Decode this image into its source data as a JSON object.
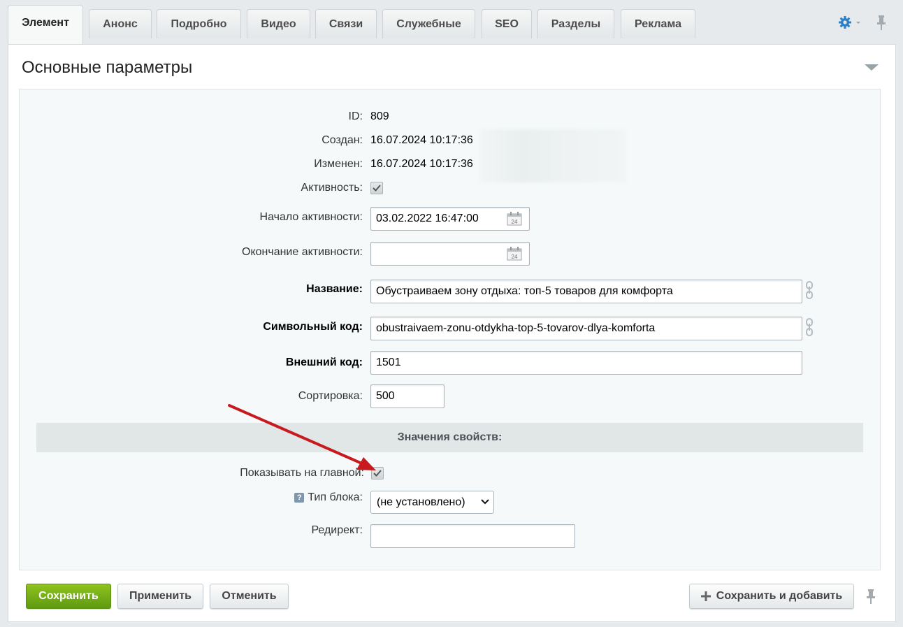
{
  "tabs": [
    {
      "label": "Элемент",
      "active": true
    },
    {
      "label": "Анонс"
    },
    {
      "label": "Подробно"
    },
    {
      "label": "Видео"
    },
    {
      "label": "Связи"
    },
    {
      "label": "Служебные"
    },
    {
      "label": "SEO"
    },
    {
      "label": "Разделы"
    },
    {
      "label": "Реклама"
    }
  ],
  "section": {
    "title": "Основные параметры"
  },
  "fields": {
    "id": {
      "label": "ID:",
      "value": "809"
    },
    "created": {
      "label": "Создан:",
      "value": "16.07.2024 10:17:36"
    },
    "modified": {
      "label": "Изменен:",
      "value": "16.07.2024 10:17:36"
    },
    "active": {
      "label": "Активность:",
      "checked": true
    },
    "active_from": {
      "label": "Начало активности:",
      "value": "03.02.2022 16:47:00"
    },
    "active_to": {
      "label": "Окончание активности:",
      "value": ""
    },
    "name": {
      "label": "Название:",
      "value": "Обустраиваем зону отдыха: топ-5 товаров для комфорта"
    },
    "code": {
      "label": "Символьный код:",
      "value": "obustraivaem-zonu-otdykha-top-5-tovarov-dlya-komforta"
    },
    "xml_id": {
      "label": "Внешний код:",
      "value": "1501"
    },
    "sort": {
      "label": "Сортировка:",
      "value": "500"
    }
  },
  "properties": {
    "header": "Значения свойств:",
    "show_on_main": {
      "label": "Показывать на главной:",
      "checked": true
    },
    "block_type": {
      "label": "Тип блока:",
      "help_icon": "?",
      "selected": "(не установлено)"
    },
    "redirect": {
      "label": "Редирект:",
      "value": ""
    }
  },
  "buttons": {
    "save": "Сохранить",
    "apply": "Применить",
    "cancel": "Отменить",
    "save_and_add": "Сохранить и добавить"
  },
  "colors": {
    "accent_green": "#6fae16",
    "annotation_arrow": "#c8191f",
    "settings_icon": "#2a7fc7"
  }
}
